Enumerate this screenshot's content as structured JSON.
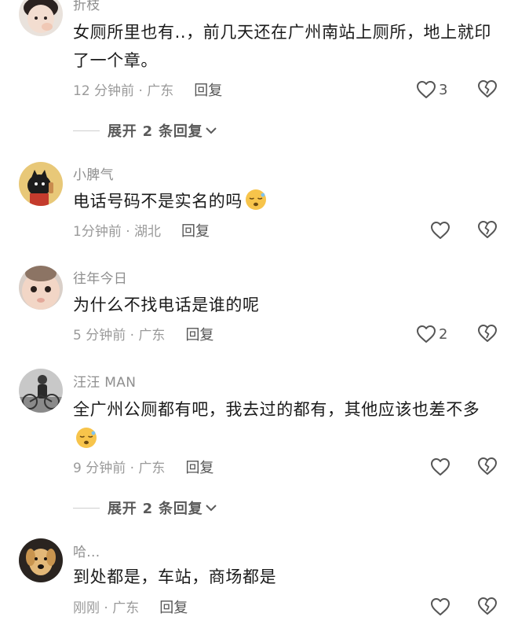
{
  "comments": [
    {
      "username": "折枝",
      "text": "女厕所里也有..，前几天还在广州南站上厕所，地上就印了一个章。",
      "time": "12 分钟前 · 广东",
      "reply_label": "回复",
      "likes": "3",
      "expand_label": "展开 2 条回复"
    },
    {
      "username": "小脾气",
      "text": "电话号码不是实名的吗",
      "time": "1分钟前 · 湖北",
      "reply_label": "回复",
      "likes": ""
    },
    {
      "username": "往年今日",
      "text": "为什么不找电话是谁的呢",
      "time": "5 分钟前 · 广东",
      "reply_label": "回复",
      "likes": "2"
    },
    {
      "username": "汪汪 MAN",
      "text": "全广州公厕都有吧，我去过的都有，其他应该也差不多",
      "time": "9 分钟前 · 广东",
      "reply_label": "回复",
      "likes": "",
      "expand_label": "展开 2 条回复"
    },
    {
      "username": "哈...",
      "text": "到处都是，车站，商场都是",
      "time": "刚刚 · 广东",
      "reply_label": "回复",
      "likes": ""
    }
  ],
  "icons": {
    "like": "heart-outline-icon",
    "dislike": "broken-heart-icon",
    "expand": "chevron-down-icon",
    "emoji": "sleepy-face-emoji"
  },
  "colors": {
    "text": "#1a1a1a",
    "meta": "#9a9a9a",
    "emoji": "#f7c44b"
  }
}
